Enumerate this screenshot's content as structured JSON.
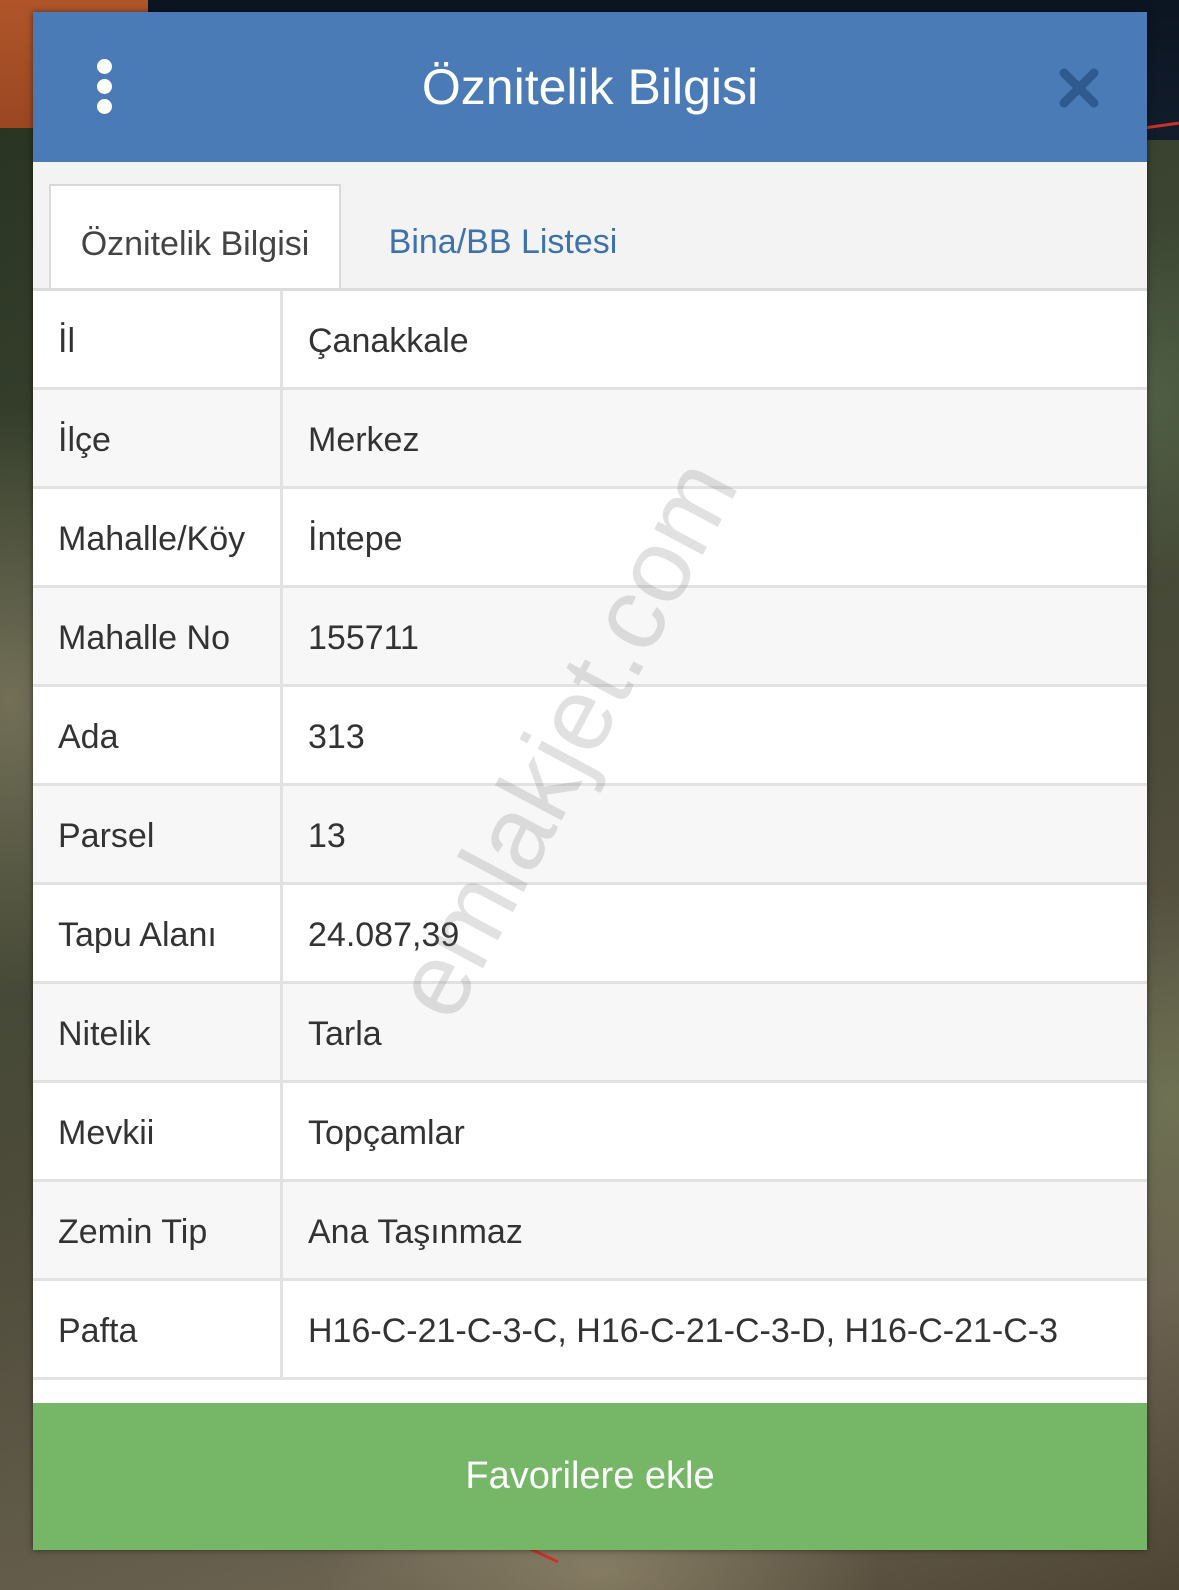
{
  "header": {
    "title": "Öznitelik Bilgisi",
    "color": "#4a7bb6"
  },
  "tabs": [
    {
      "label": "Öznitelik Bilgisi",
      "active": true
    },
    {
      "label": "Bina/BB Listesi",
      "active": false
    }
  ],
  "rows": [
    {
      "key": "İl",
      "value": "Çanakkale"
    },
    {
      "key": "İlçe",
      "value": "Merkez"
    },
    {
      "key": "Mahalle/Köy",
      "value": "İntepe"
    },
    {
      "key": "Mahalle No",
      "value": "155711"
    },
    {
      "key": "Ada",
      "value": "313"
    },
    {
      "key": "Parsel",
      "value": "13"
    },
    {
      "key": "Tapu Alanı",
      "value": "24.087,39"
    },
    {
      "key": "Nitelik",
      "value": "Tarla"
    },
    {
      "key": "Mevkii",
      "value": "Topçamlar"
    },
    {
      "key": "Zemin Tip",
      "value": "Ana Taşınmaz"
    },
    {
      "key": "Pafta",
      "value": "H16-C-21-C-3-C, H16-C-21-C-3-D, H16-C-21-C-3"
    }
  ],
  "watermark": "emlakjet.com",
  "footer": {
    "button_label": "Favorilere ekle",
    "button_color": "#75b767"
  },
  "icons": {
    "menu": "vertical-dots-icon",
    "close": "close-icon"
  }
}
